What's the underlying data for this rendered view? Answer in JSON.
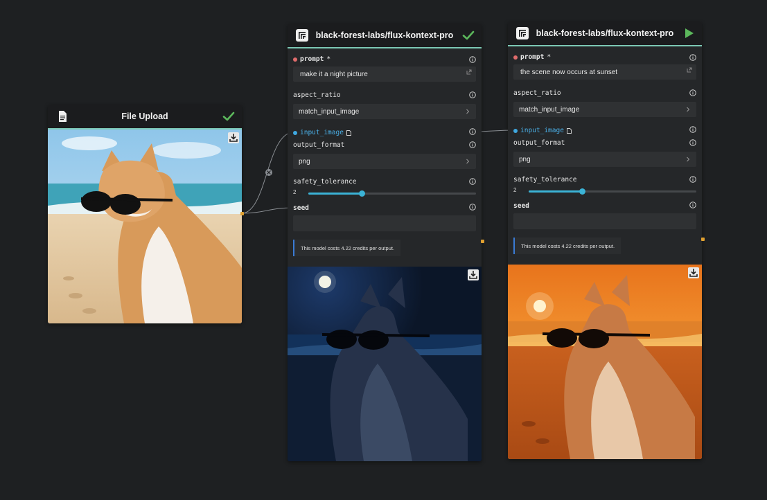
{
  "file_upload": {
    "title": "File Upload",
    "status_icon": "check-icon",
    "header_icon": "file-icon"
  },
  "nodes": [
    {
      "title": "black-forest-labs/flux-kontext-pro",
      "status_icon": "check-icon",
      "prompt_label": "prompt",
      "required_mark": "*",
      "prompt_value": "make it a night picture",
      "aspect_ratio_label": "aspect_ratio",
      "aspect_ratio_value": "match_input_image",
      "input_image_label": "input_image",
      "output_format_label": "output_format",
      "output_format_value": "png",
      "safety_tolerance_label": "safety_tolerance",
      "safety_tolerance_value": "2",
      "seed_label": "seed",
      "cost_note": "This model costs 4.22 credits per output."
    },
    {
      "title": "black-forest-labs/flux-kontext-pro",
      "status_icon": "play-icon",
      "prompt_label": "prompt",
      "required_mark": "*",
      "prompt_value": "the scene now occurs at sunset",
      "aspect_ratio_label": "aspect_ratio",
      "aspect_ratio_value": "match_input_image",
      "input_image_label": "input_image",
      "output_format_label": "output_format",
      "output_format_value": "png",
      "safety_tolerance_label": "safety_tolerance",
      "safety_tolerance_value": "2",
      "seed_label": "seed",
      "cost_note": "This model costs 4.22 credits per output."
    }
  ],
  "colors": {
    "background": "#1e2022",
    "node": "#252729",
    "accent_teal": "#7bc8b4",
    "slider": "#3bb3d6",
    "check": "#5cb85c",
    "play": "#5cb85c"
  },
  "safety_tolerance_fraction": 0.32
}
